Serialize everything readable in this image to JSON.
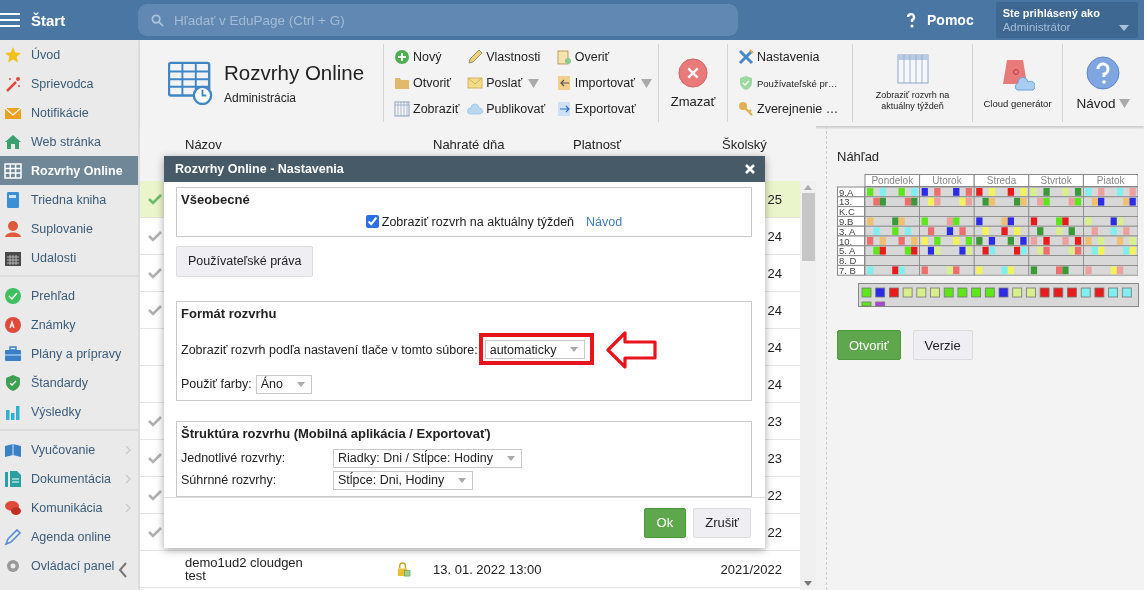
{
  "header": {
    "start_label": "Štart",
    "search": {
      "placeholder": "Hľadať v EduPage (Ctrl + G)"
    },
    "help_label": "Pomoc",
    "user": {
      "caption": "Ste prihlásený ako",
      "name": "Administrátor"
    }
  },
  "sidebar": {
    "groups": [
      [
        {
          "label": "Úvod",
          "selected": false,
          "submenu": false
        },
        {
          "label": "Sprievodca",
          "selected": false,
          "submenu": false
        },
        {
          "label": "Notifikácie",
          "selected": false,
          "submenu": false
        },
        {
          "label": "Web stránka",
          "selected": false,
          "submenu": false
        },
        {
          "label": "Rozvrhy Online",
          "selected": true,
          "submenu": false
        },
        {
          "label": "Triedna kniha",
          "selected": false,
          "submenu": false
        },
        {
          "label": "Suplovanie",
          "selected": false,
          "submenu": false
        },
        {
          "label": "Udalosti",
          "selected": false,
          "submenu": false
        }
      ],
      [
        {
          "label": "Prehľad",
          "selected": false,
          "submenu": false
        },
        {
          "label": "Známky",
          "selected": false,
          "submenu": false
        },
        {
          "label": "Plány a prípravy",
          "selected": false,
          "submenu": false
        },
        {
          "label": "Štandardy",
          "selected": false,
          "submenu": false
        },
        {
          "label": "Výsledky",
          "selected": false,
          "submenu": false
        }
      ],
      [
        {
          "label": "Vyučovanie",
          "selected": false,
          "submenu": true
        },
        {
          "label": "Dokumentácia",
          "selected": false,
          "submenu": true
        },
        {
          "label": "Komunikácia",
          "selected": false,
          "submenu": true
        },
        {
          "label": "Agenda online",
          "selected": false,
          "submenu": false
        },
        {
          "label": "Ovládací panel",
          "selected": false,
          "submenu": false
        }
      ]
    ]
  },
  "app": {
    "title": "Rozvrhy Online",
    "subtitle": "Administrácia"
  },
  "toolbar": {
    "small_columns": [
      [
        {
          "label": "Nový",
          "dropdown": false
        },
        {
          "label": "Otvoriť",
          "dropdown": false
        },
        {
          "label": "Zobraziť",
          "dropdown": false
        }
      ],
      [
        {
          "label": "Vlastnosti",
          "dropdown": false
        },
        {
          "label": "Poslať",
          "dropdown": true
        },
        {
          "label": "Publikovať",
          "dropdown": false
        }
      ],
      [
        {
          "label": "Overiť",
          "dropdown": false
        },
        {
          "label": "Importovať",
          "dropdown": true
        },
        {
          "label": "Exportovať",
          "dropdown": false
        }
      ]
    ],
    "delete_label": "Zmazať",
    "settings_column": [
      {
        "label": "Nastavenia",
        "kind": "normal"
      },
      {
        "label": "Používateľské pr…",
        "kind": "small"
      },
      {
        "label": "Zverejnenie …",
        "kind": "normal"
      }
    ],
    "big_buttons": [
      {
        "label": "Zobraziť rozvrh na aktuálny týždeň",
        "dropdown": false
      },
      {
        "label": "Cloud generátor",
        "dropdown": false
      },
      {
        "label": "Návod",
        "dropdown": true
      }
    ]
  },
  "table": {
    "columns": [
      "Názov",
      "Nahraté dňa",
      "Platnosť",
      "Školský"
    ],
    "rows": [
      {
        "checked": true,
        "selected": true,
        "school_year": "25"
      },
      {
        "checked": true,
        "selected": false,
        "school_year": "24"
      },
      {
        "checked": true,
        "selected": false,
        "school_year": "24"
      },
      {
        "checked": true,
        "selected": false,
        "school_year": "24"
      },
      {
        "checked": false,
        "selected": false,
        "school_year": "24"
      },
      {
        "checked": false,
        "selected": false,
        "school_year": "24"
      },
      {
        "checked": true,
        "selected": false,
        "school_year": "23"
      },
      {
        "checked": true,
        "selected": false,
        "school_year": "23"
      },
      {
        "checked": true,
        "selected": false,
        "school_year": "22"
      },
      {
        "checked": true,
        "selected": false,
        "school_year": "22"
      },
      {
        "checked": false,
        "selected": false,
        "name": "demo1ud2 cloudgen test",
        "uploaded": "13. 01. 2022 13:00",
        "school_year": "2021/2022"
      }
    ]
  },
  "preview": {
    "title": "Náhľad",
    "days": [
      "Pondelok",
      "Utorok",
      "Streda",
      "Stvrtok",
      "Piatok"
    ],
    "classes": [
      "9.A",
      "13.",
      "K.C",
      "9.B",
      "3. A",
      "10.",
      "5. A",
      "8. D",
      "7. B"
    ],
    "buttons": [
      {
        "label": "Otvoriť",
        "primary": true
      },
      {
        "label": "Verzie",
        "primary": false
      }
    ]
  },
  "dialog": {
    "title": "Rozvrhy Online - Nastavenia",
    "general": {
      "title": "Všeobecné",
      "checkbox": {
        "label": "Zobraziť rozvrh na aktuálny týždeň",
        "checked": true
      },
      "link": "Návod"
    },
    "rights_button": "Používateľské práva",
    "format": {
      "title": "Formát rozvrhu",
      "print_label": "Zobraziť rozvrh podľa nastavení tlače v tomto súbore:",
      "print_value": "automaticky",
      "highlighted": true,
      "colors_label": "Použiť farby:",
      "colors_value": "Áno"
    },
    "structure": {
      "title": "Štruktúra rozvrhu (Mobilná aplikácia / Exportovať)",
      "fields": [
        {
          "label": "Jednotlivé rozvrhy:",
          "value": "Riadky: Dni / Stĺpce: Hodiny"
        },
        {
          "label": "Súhrnné rozvrhy:",
          "value": "Stĺpce: Dni, Hodiny"
        }
      ]
    },
    "buttons": [
      {
        "label": "Ok",
        "primary": true
      },
      {
        "label": "Zrušiť",
        "primary": false
      }
    ]
  }
}
